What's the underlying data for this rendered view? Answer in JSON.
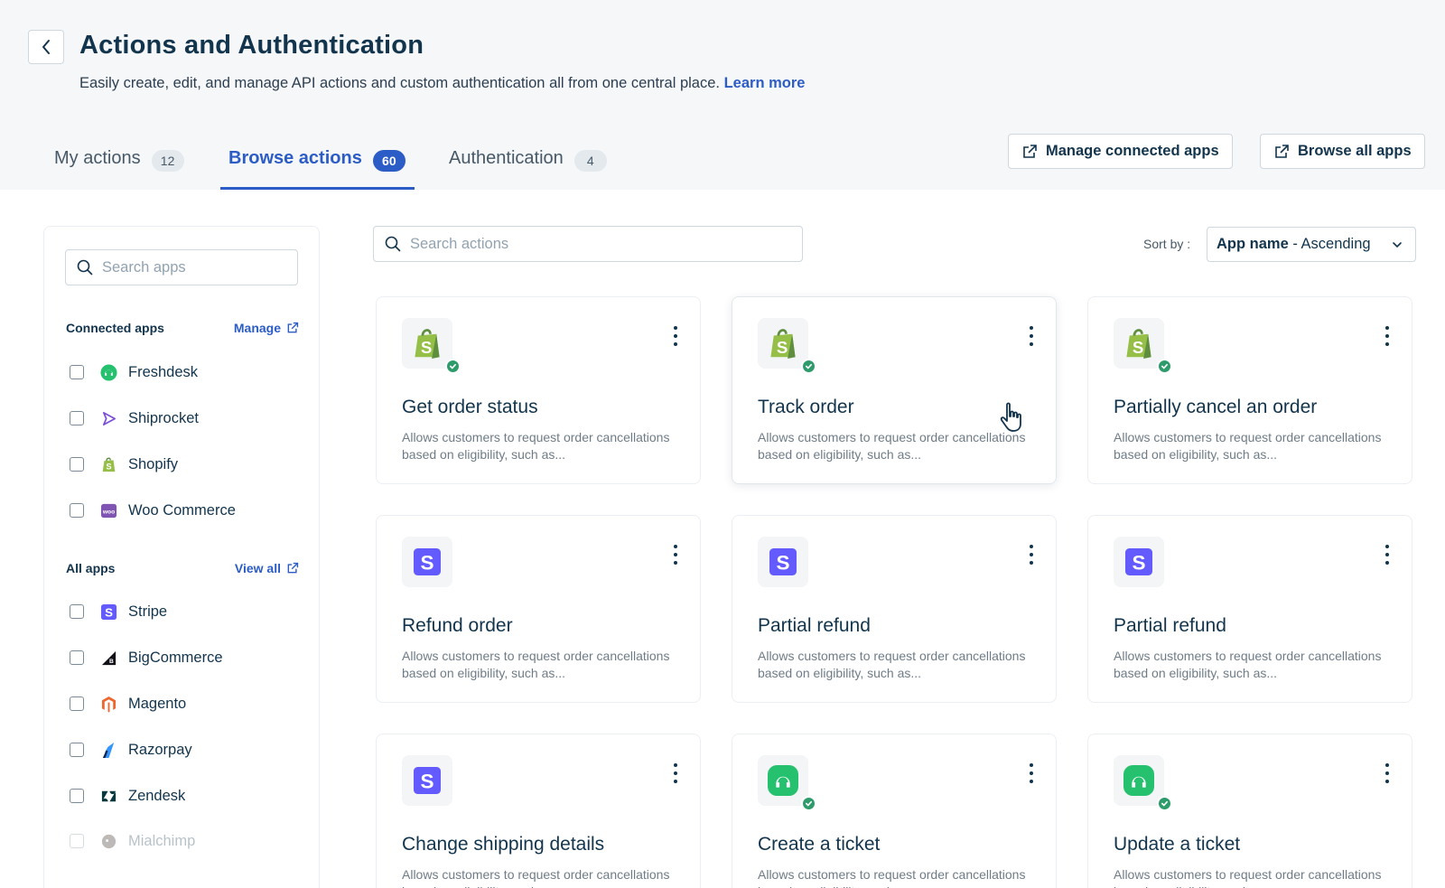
{
  "header": {
    "title": "Actions and Authentication",
    "subtitle": "Easily create, edit, and manage API actions and custom authentication all from one central place.",
    "learn_more": "Learn more"
  },
  "tabs": [
    {
      "label": "My actions",
      "count": "12"
    },
    {
      "label": "Browse actions",
      "count": "60",
      "active": true
    },
    {
      "label": "Authentication",
      "count": "4"
    }
  ],
  "header_buttons": {
    "manage_connected": "Manage connected apps",
    "browse_all": "Browse all apps"
  },
  "sidebar": {
    "search_placeholder": "Search apps",
    "connected_title": "Connected apps",
    "connected_link": "Manage",
    "connected_apps": [
      {
        "name": "Freshdesk",
        "icon": "freshdesk-icon"
      },
      {
        "name": "Shiprocket",
        "icon": "shiprocket-icon"
      },
      {
        "name": "Shopify",
        "icon": "shopify-icon"
      },
      {
        "name": "Woo Commerce",
        "icon": "woocommerce-icon"
      }
    ],
    "all_title": "All apps",
    "all_link": "View all",
    "all_apps": [
      {
        "name": "Stripe",
        "icon": "stripe-icon"
      },
      {
        "name": "BigCommerce",
        "icon": "bigcommerce-icon"
      },
      {
        "name": "Magento",
        "icon": "magento-icon"
      },
      {
        "name": "Razorpay",
        "icon": "razorpay-icon"
      },
      {
        "name": "Zendesk",
        "icon": "zendesk-icon"
      },
      {
        "name": "Mialchimp",
        "icon": "mailchimp-icon"
      }
    ]
  },
  "main": {
    "search_placeholder": "Search actions",
    "sort_label": "Sort by :",
    "sort_value_bold": "App name",
    "sort_value_rest": " - Ascending"
  },
  "cards": [
    {
      "title": "Get order status",
      "desc": "Allows customers to request order cancellations based on eligibility, such as...",
      "app": "shopify",
      "verified": true
    },
    {
      "title": "Track order",
      "desc": "Allows customers to request order cancellations based on eligibility, such as...",
      "app": "shopify",
      "verified": true
    },
    {
      "title": "Partially cancel an order",
      "desc": "Allows customers to request order cancellations based on eligibility, such as...",
      "app": "shopify",
      "verified": true
    },
    {
      "title": "Refund order",
      "desc": "Allows customers to request order cancellations based on eligibility, such as...",
      "app": "stripe",
      "verified": false
    },
    {
      "title": "Partial refund",
      "desc": "Allows customers to request order cancellations based on eligibility, such as...",
      "app": "stripe",
      "verified": false
    },
    {
      "title": "Partial refund",
      "desc": "Allows customers to request order cancellations based on eligibility, such as...",
      "app": "stripe",
      "verified": false
    },
    {
      "title": "Change shipping details",
      "desc": "Allows customers to request order cancellations based on eligibility, such as...",
      "app": "stripe",
      "verified": false
    },
    {
      "title": "Create a ticket",
      "desc": "Allows customers to request order cancellations based on eligibility, such as...",
      "app": "freshdesk",
      "verified": true
    },
    {
      "title": "Update a ticket",
      "desc": "Allows customers to request order cancellations based on eligibility, such as...",
      "app": "freshdesk",
      "verified": true
    }
  ],
  "colors": {
    "brand": "#2c5cc5",
    "shopify": "#95bf47",
    "stripe": "#635bff",
    "freshdesk": "#25c16f",
    "verified": "#2e9b6b"
  }
}
